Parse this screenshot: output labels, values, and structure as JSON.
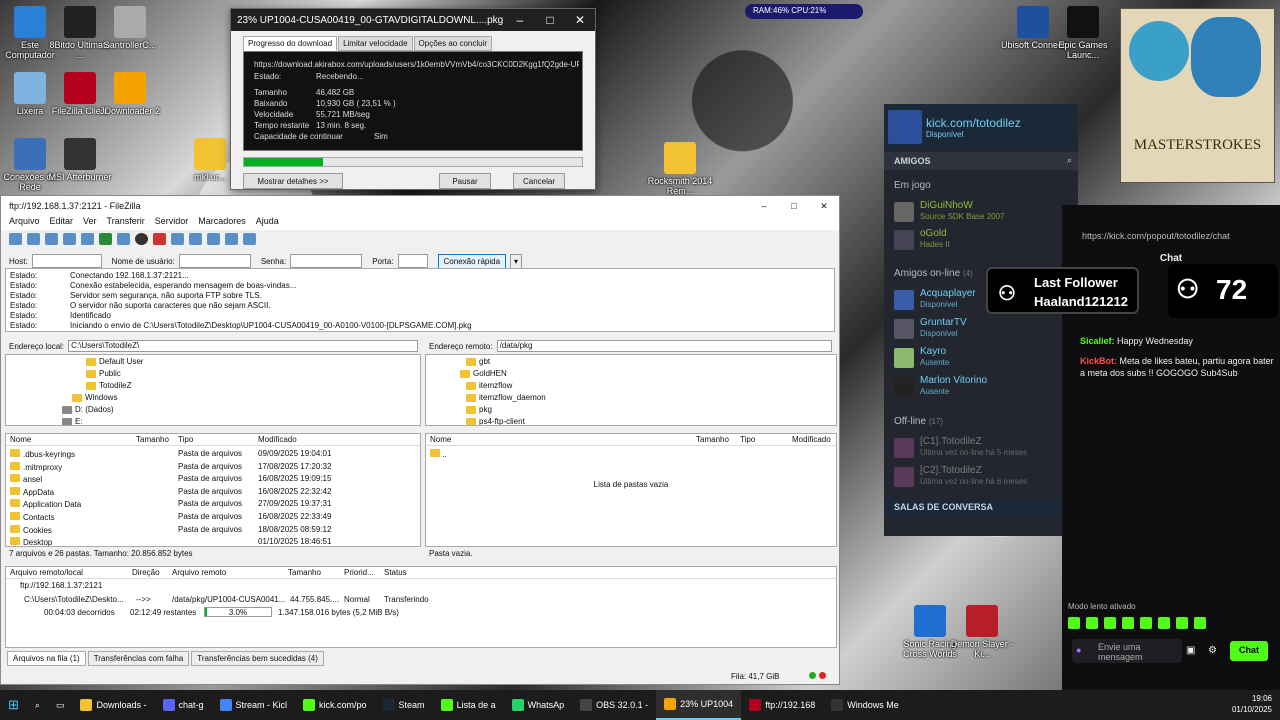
{
  "desktop": {
    "icons": [
      {
        "label": "Este Computador",
        "color": "#2a7fd6"
      },
      {
        "label": "8Bitdo Ultimate ...",
        "color": "#222"
      },
      {
        "label": "SantrollerC...",
        "color": "#aaa"
      },
      {
        "label": "Lixeira",
        "color": "#7fb3e0"
      },
      {
        "label": "FileZilla Client",
        "color": "#b2001e"
      },
      {
        "label": "JDownloader 2",
        "color": "#f4a300"
      },
      {
        "label": "Conexões de Rede",
        "color": "#3b6fb6"
      },
      {
        "label": "MSI Afterburner",
        "color": "#333"
      },
      {
        "label": "mkl.ur...",
        "color": "#f1c232"
      },
      {
        "label": "Rocksmith 2014 Rem...",
        "color": "#f1c232"
      },
      {
        "label": "Ubisoft Connect",
        "color": "#1e50a0"
      },
      {
        "label": "Epic Games Launc...",
        "color": "#111"
      },
      {
        "label": "Sonic Racing Cross Worlds",
        "color": "#1e6fd0"
      },
      {
        "label": "Demon Slayer -Ki...",
        "color": "#b81e2a"
      }
    ],
    "ram_cpu": "RAM:46%  CPU:21%",
    "masterstrokes": "MASTERSTROKES"
  },
  "download_dialog": {
    "title": "23% UP1004-CUSA00419_00-GTAVDIGITALDOWNL....pkg",
    "tabs": [
      "Progresso do download",
      "Limitar velocidade",
      "Opções ao concluir"
    ],
    "url": "https://download.akirabox.com/uploads/users/1k0embVVmVb4/co3CKC0D2Kgg1fQ2gde-UP1004-CUS",
    "estado_label": "Estado:",
    "estado_value": "Recebendo...",
    "rows": [
      {
        "k": "Tamanho",
        "v": "46,482 GB"
      },
      {
        "k": "Baixando",
        "v": "10,930 GB ( 23,51 % )"
      },
      {
        "k": "Velocidade",
        "v": "55,721 MB/seg"
      },
      {
        "k": "Tempo restante",
        "v": "13 min. 8 seg."
      },
      {
        "k": "Capacidade de continuar",
        "v": "Sim"
      }
    ],
    "progress": 0.235,
    "details_button": "Mostrar detalhes >>",
    "pause_button": "Pausar",
    "cancel_button": "Cancelar"
  },
  "filezilla": {
    "title": "ftp://192.168.1.37:2121 - FileZilla",
    "menu": [
      "Arquivo",
      "Editar",
      "Ver",
      "Transferir",
      "Servidor",
      "Marcadores",
      "Ajuda"
    ],
    "quick": {
      "host_label": "Host:",
      "user_label": "Nome de usuário:",
      "pass_label": "Senha:",
      "port_label": "Porta:",
      "connect_button": "Conexão rápida"
    },
    "log": [
      {
        "k": "Estado:",
        "v": "Conectando 192.168.1.37:2121..."
      },
      {
        "k": "Estado:",
        "v": "Conexão estabelecida, esperando mensagem de boas-vindas..."
      },
      {
        "k": "Estado:",
        "v": "Servidor sem segurança, não suporta FTP sobre TLS."
      },
      {
        "k": "Estado:",
        "v": "O servidor não suporta caracteres que não sejam ASCII."
      },
      {
        "k": "Estado:",
        "v": "Identificado"
      },
      {
        "k": "Estado:",
        "v": "Iniciando o envio de C:\\Users\\TotodileZ\\Desktop\\UP1004-CUSA00419_00-A0100-V0100-[DLPSGAME.COM].pkg"
      }
    ],
    "local": {
      "label": "Endereço local:",
      "path": "C:\\Users\\TotodileZ\\",
      "tree": [
        "Default User",
        "Public",
        "TotodileZ",
        "Windows",
        "D: (Dados)",
        "E:"
      ],
      "headers": [
        "Nome",
        "Tamanho",
        "Tipo",
        "Modificado"
      ],
      "files": [
        {
          "name": ".dbus-keyrings",
          "type": "Pasta de arquivos",
          "mod": "09/09/2025 19:04:01"
        },
        {
          "name": ".mitmproxy",
          "type": "Pasta de arquivos",
          "mod": "17/08/2025 17:20:32"
        },
        {
          "name": "ansel",
          "type": "Pasta de arquivos",
          "mod": "16/08/2025 19:09:15"
        },
        {
          "name": "AppData",
          "type": "Pasta de arquivos",
          "mod": "16/08/2025 22:32:42"
        },
        {
          "name": "Application Data",
          "type": "Pasta de arquivos",
          "mod": "27/09/2025 19:37:31"
        },
        {
          "name": "Contacts",
          "type": "Pasta de arquivos",
          "mod": "16/08/2025 22:33:49"
        },
        {
          "name": "Cookies",
          "type": "Pasta de arquivos",
          "mod": "18/08/2025 08:59:12"
        },
        {
          "name": "Desktop",
          "type": "",
          "mod": "01/10/2025 18:46:51"
        }
      ],
      "status": "7 arquivos e 26 pastas. Tamanho: 20.856.852 bytes"
    },
    "remote": {
      "label": "Endereço remoto:",
      "path": "/data/pkg",
      "tree": [
        "gbt",
        "GoldHEN",
        "itemzflow",
        "itemzflow_daemon",
        "pkg",
        "ps4-ftp-client"
      ],
      "headers": [
        "Nome",
        "Tamanho",
        "Tipo",
        "Modificado"
      ],
      "parent": "..",
      "empty": "Lista de pastas vazia",
      "status": "Pasta vazia."
    },
    "queue": {
      "headers": [
        "Arquivo remoto/local",
        "Direção",
        "Arquivo remoto",
        "Tamanho",
        "Priorid...",
        "Status"
      ],
      "server": "ftp://192.168.1.37:2121",
      "item": {
        "local": "C:\\Users\\TotodileZ\\Deskto...",
        "dir": "-->>",
        "remote": "/data/pkg/UP1004-CUSA0041...",
        "size": "44.755.845....",
        "prio": "Normal",
        "status": "Transferindo"
      },
      "elapsed": "00:04:03 decorridos",
      "remaining": "02:12:49 restantes",
      "percent_label": "3.0%",
      "percent": 0.03,
      "bytes": "1.347.158.016 bytes (5,2 MiB B/s)",
      "tabs": [
        "Arquivos na fila (1)",
        "Transferências com falha",
        "Transferências bem sucedidas (4)"
      ],
      "fila": "Fila: 41,7 GiB"
    }
  },
  "steam": {
    "profile_name": "kick.com/totodilez",
    "profile_status": "Disponível",
    "friends_label": "AMIGOS",
    "ingame_label": "Em jogo",
    "ingame": [
      {
        "name": "DiGuiNhoW",
        "game": "Source SDK Base 2007"
      },
      {
        "name": "oGold",
        "game": "Hades II"
      }
    ],
    "online_label": "Amigos on-line",
    "online_count": "(4)",
    "online": [
      {
        "name": "Acquaplayer",
        "status": "Disponível"
      },
      {
        "name": "GruntarTV",
        "status": "Disponível"
      },
      {
        "name": "Kayro",
        "status": "Ausente"
      },
      {
        "name": "Marlon Vitorino",
        "status": "Ausente"
      }
    ],
    "offline_label": "Off-line",
    "offline_count": "(17)",
    "offline": [
      {
        "name": "[C1].TotodileZ",
        "status": "Última vez on-line há 5 meses"
      },
      {
        "name": "[C2].TotodileZ",
        "status": "Última vez on-line há 6 meses"
      }
    ],
    "rooms_label": "SALAS DE CONVERSA"
  },
  "overlays": {
    "last_follower_title": "Last Follower",
    "last_follower_name": "Haaland121212",
    "viewers": "72"
  },
  "kick": {
    "url": "https://kick.com/popout/totodilez/chat",
    "title": "Chat",
    "msg1_user": "Sicalief:",
    "msg1_text": "Happy Wednesday",
    "msg2_user": "KickBot:",
    "msg2_text": "Meta de likes bateu, partiu agora bater a meta dos subs !! GOGOGO Sub4Sub",
    "slow_mode": "Modo lento ativado",
    "input_placeholder": "Envie uma mensagem",
    "chat_button": "Chat"
  },
  "taskbar": {
    "items": [
      {
        "label": "Downloads -",
        "color": "#f1c232"
      },
      {
        "label": "chat-g",
        "color": "#5865f2"
      },
      {
        "label": "Stream - Kicl",
        "color": "#4285f4"
      },
      {
        "label": "kick.com/po",
        "color": "#53fc18"
      },
      {
        "label": "Steam",
        "color": "#1b2838"
      },
      {
        "label": "Lista de a",
        "color": "#53fc18"
      },
      {
        "label": "WhatsAp",
        "color": "#25d366"
      },
      {
        "label": "OBS 32.0.1 -",
        "color": "#444"
      },
      {
        "label": "23% UP1004",
        "color": "#f4a300"
      },
      {
        "label": "ftp://192.168",
        "color": "#b2001e"
      },
      {
        "label": "Windows Me",
        "color": "#333"
      }
    ],
    "time": "19:06",
    "date": "01/10/2025"
  }
}
